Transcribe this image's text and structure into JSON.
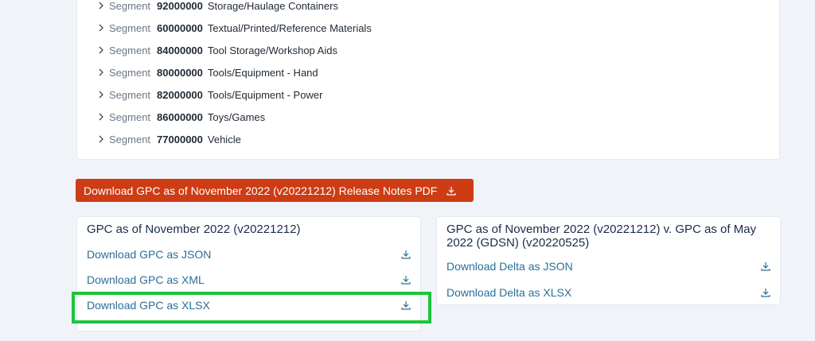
{
  "segments": [
    {
      "word": "Segment",
      "code": "92000000",
      "name": "Storage/Haulage Containers"
    },
    {
      "word": "Segment",
      "code": "60000000",
      "name": "Textual/Printed/Reference Materials"
    },
    {
      "word": "Segment",
      "code": "84000000",
      "name": "Tool Storage/Workshop Aids"
    },
    {
      "word": "Segment",
      "code": "80000000",
      "name": "Tools/Equipment - Hand"
    },
    {
      "word": "Segment",
      "code": "82000000",
      "name": "Tools/Equipment - Power"
    },
    {
      "word": "Segment",
      "code": "86000000",
      "name": "Toys/Games"
    },
    {
      "word": "Segment",
      "code": "77000000",
      "name": "Vehicle"
    }
  ],
  "release_button": {
    "label": "Download GPC as of November 2022 (v20221212) Release Notes PDF"
  },
  "left_panel": {
    "title": "GPC as of November 2022 (v20221212)",
    "links": [
      {
        "label": "Download GPC as JSON"
      },
      {
        "label": "Download GPC as XML"
      },
      {
        "label": "Download GPC as XLSX"
      }
    ]
  },
  "right_panel": {
    "title": "GPC as of November 2022 (v20221212) v. GPC as of May 2022 (GDSN) (v20220525)",
    "links": [
      {
        "label": "Download Delta as JSON"
      },
      {
        "label": "Download Delta as XLSX"
      }
    ]
  },
  "colors": {
    "accent_button": "#cd3c14",
    "link": "#2a6f97",
    "highlight": "#1cc43c"
  },
  "icons": {
    "row_chevron": "chevron-right-icon",
    "download": "download-icon"
  }
}
